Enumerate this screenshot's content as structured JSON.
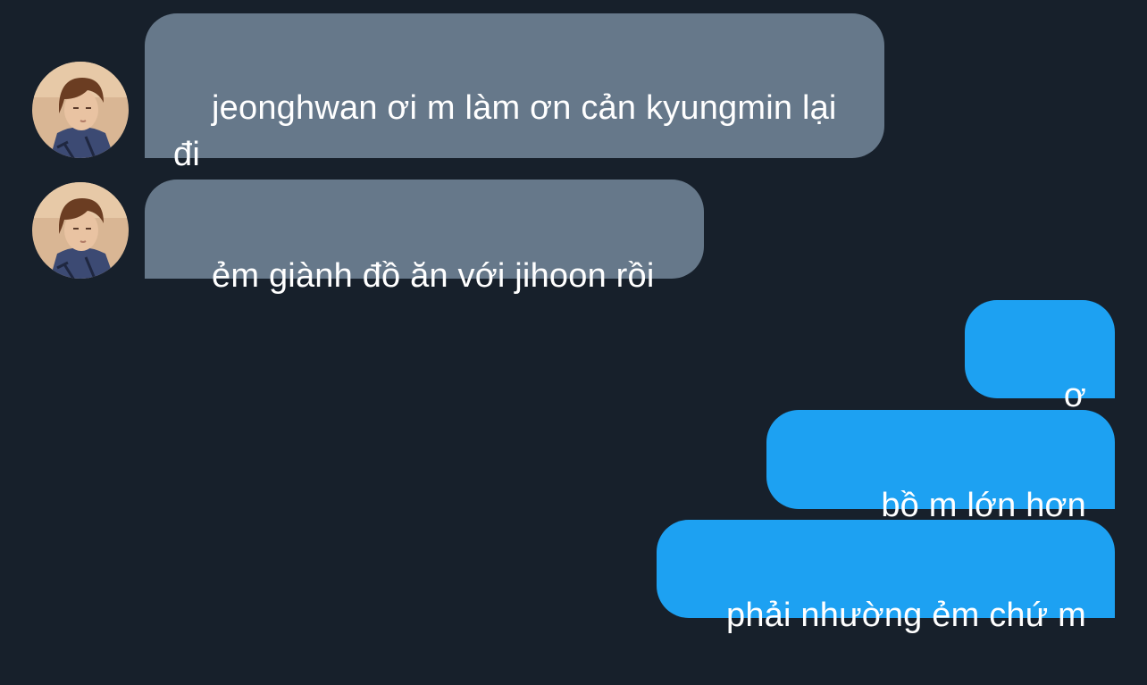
{
  "conversation": {
    "incoming_avatar": "profile-photo-icon",
    "messages": [
      {
        "direction": "incoming",
        "text": "jeonghwan ơi m làm ơn cản kyungmin lại đi"
      },
      {
        "direction": "incoming",
        "text": "ẻm giành đồ ăn với jihoon rồi"
      },
      {
        "direction": "outgoing",
        "text": "ơ hay"
      },
      {
        "direction": "outgoing",
        "text": "bồ m lớn hơn ẻm"
      },
      {
        "direction": "outgoing",
        "text": "phải nhường ẻm chứ m"
      }
    ]
  },
  "colors": {
    "background": "#17202b",
    "incoming_bubble": "#66788a",
    "outgoing_bubble": "#1da1f2",
    "text": "#ffffff"
  }
}
